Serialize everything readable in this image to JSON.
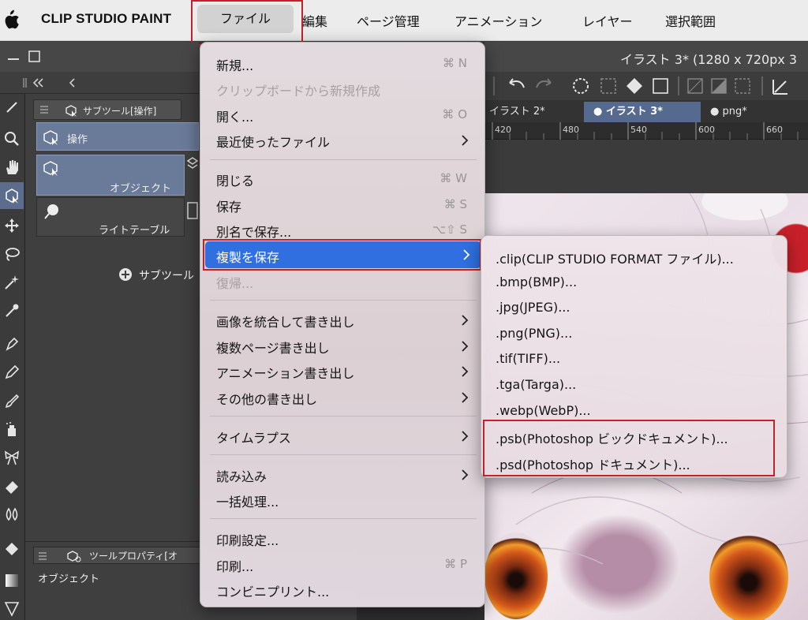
{
  "menubar": {
    "app_name": "CLIP STUDIO PAINT",
    "items": [
      "ファイル",
      "編集",
      "ページ管理",
      "アニメーション",
      "レイヤー",
      "選択範囲"
    ]
  },
  "window": {
    "title": "イラスト 3* (1280 x 720px 3"
  },
  "document_tabs": [
    "イラスト 2*",
    "● イラスト 3*",
    "● png*"
  ],
  "ruler": [
    "420",
    "480",
    "540",
    "600",
    "660"
  ],
  "subtool_panel": {
    "tab_label": "サブツール[操作]",
    "group_label": "操作",
    "object_label": "オブジェクト",
    "lighttable_label": "ライトテーブル",
    "add_subtool": "サブツール"
  },
  "tool_property_panel": {
    "tab_label": "ツールプロパティ[オ",
    "content_label": "オブジェクト"
  },
  "file_menu": {
    "items": [
      {
        "label": "新規...",
        "shortcut": "⌘ N"
      },
      {
        "label": "クリップボードから新規作成",
        "disabled": true
      },
      {
        "label": "開く...",
        "shortcut": "⌘ O"
      },
      {
        "label": "最近使ったファイル",
        "submenu": true
      },
      {
        "label": "閉じる",
        "shortcut": "⌘ W"
      },
      {
        "label": "保存",
        "shortcut": "⌘ S"
      },
      {
        "label": "別名で保存...",
        "shortcut": "⌥⇧ S"
      },
      {
        "label": "複製を保存",
        "submenu": true,
        "highlighted": true
      },
      {
        "label": "復帰...",
        "disabled": true
      },
      {
        "label": "画像を統合して書き出し",
        "submenu": true
      },
      {
        "label": "複数ページ書き出し",
        "submenu": true
      },
      {
        "label": "アニメーション書き出し",
        "submenu": true
      },
      {
        "label": "その他の書き出し",
        "submenu": true
      },
      {
        "label": "タイムラプス",
        "submenu": true
      },
      {
        "label": "読み込み",
        "submenu": true
      },
      {
        "label": "一括処理..."
      },
      {
        "label": "印刷設定..."
      },
      {
        "label": "印刷...",
        "shortcut": "⌘ P"
      },
      {
        "label": "コンビニプリント..."
      }
    ]
  },
  "save_copy_submenu": {
    "items": [
      ".clip(CLIP STUDIO FORMAT ファイル)...",
      ".bmp(BMP)...",
      ".jpg(JPEG)...",
      ".png(PNG)...",
      ".tif(TIFF)...",
      ".tga(Targa)...",
      ".webp(WebP)...",
      ".psb(Photoshop ビックドキュメント)...",
      ".psd(Photoshop ドキュメント)..."
    ]
  },
  "colors": {
    "highlight": "#2f6fe0",
    "annotation_red": "#c8202a",
    "menubar_bg": "#ececec",
    "panel_dark": "#3f3f3f"
  }
}
